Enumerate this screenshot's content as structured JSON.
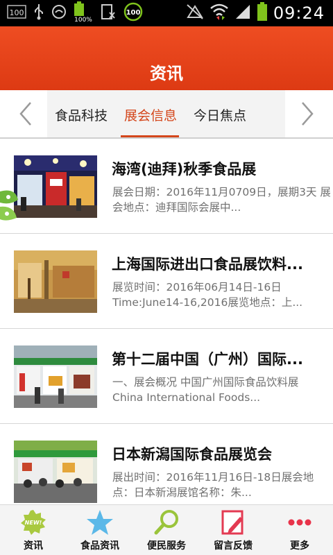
{
  "status_bar": {
    "time": "09:24",
    "battery_percent": "100%",
    "badge_100": "100",
    "box_100": "100",
    "icons": [
      "storage-100-icon",
      "usb-icon",
      "android-debug-icon",
      "battery-full-icon",
      "screenshot-icon",
      "badge-100-icon",
      "no-signal-icon",
      "wifi-icon",
      "signal-bars-icon",
      "battery-icon"
    ]
  },
  "header": {
    "title": "资讯"
  },
  "tabs": {
    "items": [
      {
        "label": "食品科技"
      },
      {
        "label": "展会信息"
      },
      {
        "label": "今日焦点"
      }
    ],
    "active_index": 1,
    "accent_color": "#d4461b"
  },
  "news": [
    {
      "title": "海湾(迪拜)秋季食品展",
      "desc": "展会日期：2016年11月0709日，展期3天 展会地点：迪拜国际会展中..."
    },
    {
      "title": "上海国际进出口食品展饮料...",
      "desc": "展览时间：2016年06月14日-16日 Time:June14-16,2016展览地点：上..."
    },
    {
      "title": "第十二届中国（广州）国际...",
      "desc": "一、展会概况 中国广州国际食品饮料展 China International Foods..."
    },
    {
      "title": "日本新潟国际食品展览会",
      "desc": "展出时间：2016年11月16日-18日展会地点：日本新潟展馆名称：朱..."
    }
  ],
  "bottom_nav": [
    {
      "label": "资讯",
      "icon": "new-badge-icon"
    },
    {
      "label": "食品资讯",
      "icon": "star-icon"
    },
    {
      "label": "便民服务",
      "icon": "magnifier-icon"
    },
    {
      "label": "留言反馈",
      "icon": "edit-note-icon"
    },
    {
      "label": "更多",
      "icon": "more-dots-icon"
    }
  ],
  "colors": {
    "header": "#e5441b",
    "accent": "#d4461b"
  }
}
